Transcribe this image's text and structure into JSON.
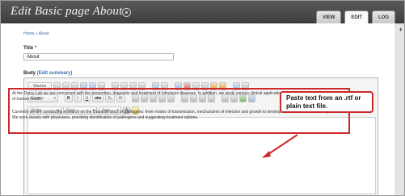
{
  "page": {
    "title": "Edit Basic page About",
    "tabs": [
      "VIEW",
      "EDIT",
      "LOG"
    ],
    "breadcrumb": "Home » About"
  },
  "form": {
    "title_label": "Title",
    "title_required_mark": "*",
    "title_value": "About",
    "body_label": "Body",
    "edit_summary_link": "(Edit summary)"
  },
  "toolbar": {
    "source_label": "Source",
    "format_placeholder": "Format",
    "styles_placeholder": "Styles",
    "font_placeholder": "Font",
    "size_placeholder": "Size",
    "bold": "B",
    "italic": "I",
    "underline": "U",
    "strike": "abc",
    "subscript": "X₂",
    "superscript": "X²",
    "text_color": "A"
  },
  "editor": {
    "paragraph_1": "At the Darcy Lab we are concerned with the prevention, diagnosis and treatment of infectious diseases. In addition, we study various clinical applications of microbes for the improvement of human health.",
    "paragraph_2": "Currently we are conducting research on the characteristics of pathogens: their modes of transmission, mechanisms of infection and growth to develop more effective treatment protocols. We work closely with physicians, providing identification of pathogens and suggesting treatment options."
  },
  "annotation": {
    "callout_text": "Paste text from an .rtf or plain text file."
  },
  "colors": {
    "header_bg": "#4a4a4a",
    "accent_red": "#cc2a2a",
    "link_blue": "#3b6fa8"
  }
}
